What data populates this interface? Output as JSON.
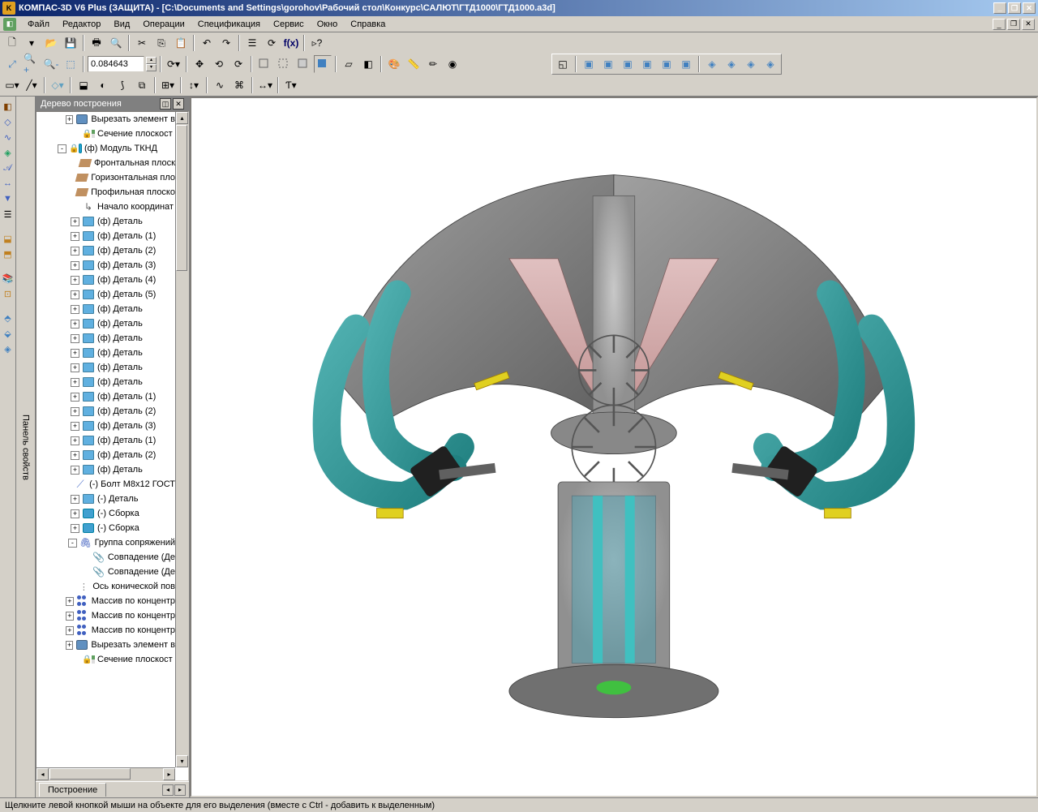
{
  "titlebar": {
    "app": "КОМПАС-3D V6 Plus (ЗАЩИТА)",
    "doc": "[C:\\Documents and Settings\\gorohov\\Рабочий стол\\Конкурс\\САЛЮТ\\ГТД1000\\ГТД1000.a3d]"
  },
  "menu": {
    "file": "Файл",
    "edit": "Редактор",
    "view": "Вид",
    "ops": "Операции",
    "spec": "Спецификация",
    "service": "Сервис",
    "window": "Окно",
    "help": "Справка"
  },
  "toolbar": {
    "zoom_value": "0.084643"
  },
  "side_panel_label": "Панель свойств",
  "tree": {
    "title": "Дерево построения",
    "tab": "Построение",
    "items": [
      {
        "indent": 2,
        "expand": "+",
        "icon": "cut-element-icon",
        "label": "Вырезать элемент в"
      },
      {
        "indent": 2,
        "expand": "",
        "icon": "section-icon",
        "label": "Сечение плоскост"
      },
      {
        "indent": 1,
        "expand": "-",
        "icon": "assembly-icon",
        "label": "(ф) Модуль ТКНД"
      },
      {
        "indent": 2,
        "expand": "",
        "icon": "plane-icon",
        "label": "Фронтальная плоск"
      },
      {
        "indent": 2,
        "expand": "",
        "icon": "plane-icon",
        "label": "Горизонтальная пло"
      },
      {
        "indent": 2,
        "expand": "",
        "icon": "plane-icon",
        "label": "Профильная плоско"
      },
      {
        "indent": 2,
        "expand": "",
        "icon": "origin-icon",
        "label": "Начало координат"
      },
      {
        "indent": 2,
        "expand": "+",
        "icon": "part-icon",
        "label": "(ф) Деталь"
      },
      {
        "indent": 2,
        "expand": "+",
        "icon": "part-icon",
        "label": "(ф) Деталь (1)"
      },
      {
        "indent": 2,
        "expand": "+",
        "icon": "part-icon",
        "label": "(ф) Деталь (2)"
      },
      {
        "indent": 2,
        "expand": "+",
        "icon": "part-icon",
        "label": "(ф) Деталь (3)"
      },
      {
        "indent": 2,
        "expand": "+",
        "icon": "part-icon",
        "label": "(ф) Деталь (4)"
      },
      {
        "indent": 2,
        "expand": "+",
        "icon": "part-icon",
        "label": "(ф) Деталь (5)"
      },
      {
        "indent": 2,
        "expand": "+",
        "icon": "part-icon",
        "label": "(ф) Деталь"
      },
      {
        "indent": 2,
        "expand": "+",
        "icon": "part-icon",
        "label": "(ф) Деталь"
      },
      {
        "indent": 2,
        "expand": "+",
        "icon": "part-icon",
        "label": "(ф) Деталь"
      },
      {
        "indent": 2,
        "expand": "+",
        "icon": "part-icon",
        "label": "(ф) Деталь"
      },
      {
        "indent": 2,
        "expand": "+",
        "icon": "part-icon",
        "label": "(ф) Деталь"
      },
      {
        "indent": 2,
        "expand": "+",
        "icon": "part-icon",
        "label": "(ф) Деталь"
      },
      {
        "indent": 2,
        "expand": "+",
        "icon": "part-icon",
        "label": "(ф) Деталь (1)"
      },
      {
        "indent": 2,
        "expand": "+",
        "icon": "part-icon",
        "label": "(ф) Деталь (2)"
      },
      {
        "indent": 2,
        "expand": "+",
        "icon": "part-icon",
        "label": "(ф) Деталь (3)"
      },
      {
        "indent": 2,
        "expand": "+",
        "icon": "part-icon",
        "label": "(ф) Деталь (1)"
      },
      {
        "indent": 2,
        "expand": "+",
        "icon": "part-icon",
        "label": "(ф) Деталь (2)"
      },
      {
        "indent": 2,
        "expand": "+",
        "icon": "part-icon",
        "label": "(ф) Деталь"
      },
      {
        "indent": 2,
        "expand": "",
        "icon": "bolt-icon",
        "label": "(-) Болт М8x12 ГОСТ"
      },
      {
        "indent": 2,
        "expand": "+",
        "icon": "part-icon",
        "label": "(-) Деталь"
      },
      {
        "indent": 2,
        "expand": "+",
        "icon": "subassembly-icon",
        "label": "(-) Сборка"
      },
      {
        "indent": 2,
        "expand": "+",
        "icon": "subassembly-icon",
        "label": "(-) Сборка"
      },
      {
        "indent": 2,
        "expand": "-",
        "icon": "mates-icon",
        "label": "Группа сопряжений"
      },
      {
        "indent": 3,
        "expand": "",
        "icon": "mate-coincide-icon",
        "label": "Совпадение (Де"
      },
      {
        "indent": 3,
        "expand": "",
        "icon": "mate-coincide-icon",
        "label": "Совпадение (Де"
      },
      {
        "indent": 2,
        "expand": "",
        "icon": "axis-icon",
        "label": "Ось конической пов"
      },
      {
        "indent": 2,
        "expand": "+",
        "icon": "pattern-icon",
        "label": "Массив по концентр"
      },
      {
        "indent": 2,
        "expand": "+",
        "icon": "pattern-icon",
        "label": "Массив по концентр"
      },
      {
        "indent": 2,
        "expand": "+",
        "icon": "pattern-icon",
        "label": "Массив по концентр"
      },
      {
        "indent": 2,
        "expand": "+",
        "icon": "cut-element-icon",
        "label": "Вырезать элемент в"
      },
      {
        "indent": 2,
        "expand": "",
        "icon": "section-icon",
        "label": "Сечение плоскост"
      }
    ]
  },
  "status": "Щелкните левой кнопкой мыши на объекте для его выделения (вместе с Ctrl - добавить к выделенным)"
}
